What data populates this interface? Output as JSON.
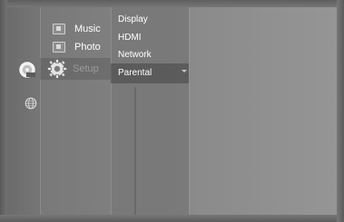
{
  "main_menu": {
    "items": [
      {
        "label": "Music",
        "icon": "music-icon"
      },
      {
        "label": "Photo",
        "icon": "photo-icon"
      },
      {
        "label": "Setup",
        "icon": "gear-icon"
      }
    ]
  },
  "side_icons": [
    {
      "icon": "disc-icon"
    },
    {
      "icon": "internet-globe-icon"
    }
  ],
  "setup_submenu": {
    "items": [
      {
        "label": "Display"
      },
      {
        "label": "HDMI"
      },
      {
        "label": "Network"
      },
      {
        "label": "Parental"
      }
    ],
    "selected": "Parental"
  },
  "colors": {
    "highlight": "#4a4a4a",
    "text": "#ffffff",
    "dim_text": "#9b9b9b"
  }
}
